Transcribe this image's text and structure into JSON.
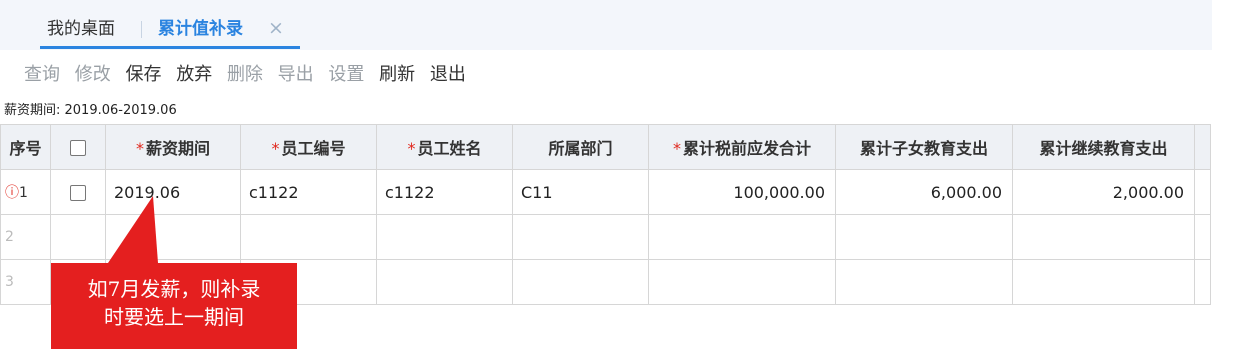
{
  "tabs": {
    "home_label": "我的桌面",
    "active_label": "累计值补录",
    "close_glyph": "×"
  },
  "toolbar": {
    "query": "查询",
    "edit": "修改",
    "save": "保存",
    "discard": "放弃",
    "delete": "删除",
    "export": "导出",
    "settings": "设置",
    "refresh": "刷新",
    "exit": "退出"
  },
  "period_info": "薪资期间: 2019.06-2019.06",
  "table": {
    "headers": {
      "seq": "序号",
      "period": "薪资期间",
      "emp_no": "员工编号",
      "emp_name": "员工姓名",
      "dept": "所属部门",
      "pre_tax_total": "累计税前应发合计",
      "child_edu": "累计子女教育支出",
      "cont_edu": "累计继续教育支出"
    },
    "required_mark": "*",
    "rows": [
      {
        "seq": "1",
        "warn_icon": "ⓘ",
        "period": "2019.06",
        "emp_no": "c1122",
        "emp_name": "c1122",
        "dept": "C11",
        "pre_tax_total": "100,000.00",
        "child_edu": "6,000.00",
        "cont_edu": "2,000.00"
      },
      {
        "seq": "2"
      },
      {
        "seq": "3"
      }
    ]
  },
  "annotation": {
    "line1": "如7月发薪，则补录",
    "line2": "时要选上一期间",
    "color": "#e41f1f"
  },
  "colors": {
    "accent": "#2b84e0",
    "required": "#e0281e",
    "header_bg": "#eef1f5"
  }
}
